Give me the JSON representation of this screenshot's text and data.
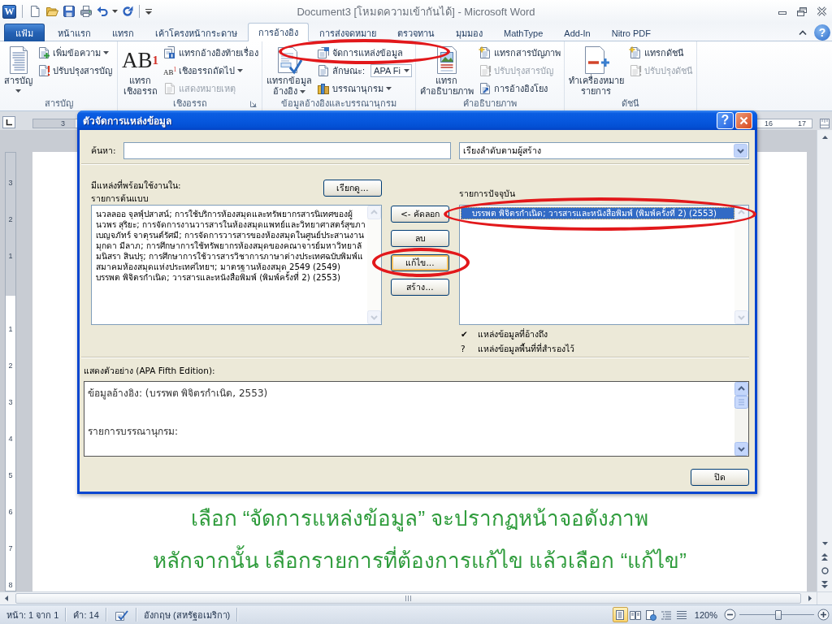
{
  "window": {
    "app_icon_letter": "W",
    "title": "Document3 [โหมดความเข้ากันได้] - Microsoft Word"
  },
  "ribbon": {
    "file_tab": "แฟ้ม",
    "tabs": [
      {
        "label": "หน้าแรก",
        "selected": false
      },
      {
        "label": "แทรก",
        "selected": false
      },
      {
        "label": "เค้าโครงหน้ากระดาษ",
        "selected": false
      },
      {
        "label": "การอ้างอิง",
        "selected": true
      },
      {
        "label": "การส่งจดหมาย",
        "selected": false
      },
      {
        "label": "ตรวจทาน",
        "selected": false
      },
      {
        "label": "มุมมอง",
        "selected": false
      },
      {
        "label": "MathType",
        "selected": false
      },
      {
        "label": "Add-In",
        "selected": false
      },
      {
        "label": "Nitro PDF",
        "selected": false
      }
    ],
    "help_button": "?",
    "groups": [
      {
        "label": "สารบัญ",
        "launcher": false,
        "items": [
          {
            "kind": "large",
            "label": "สารบัญ",
            "dropdown": true,
            "disabled": false,
            "circled": false
          },
          {
            "kind": "small",
            "label": "เพิ่มข้อความ",
            "dropdown": true,
            "disabled": false,
            "circled": false
          },
          {
            "kind": "small",
            "label": "ปรับปรุงสารบัญ",
            "dropdown": false,
            "disabled": false,
            "circled": false
          }
        ]
      },
      {
        "label": "เชิงอรรถ",
        "launcher": true,
        "items": [
          {
            "kind": "large",
            "label": "แทรก\nเชิงอรรถ",
            "icon_text": "AB$^{1}$",
            "dropdown": false,
            "disabled": false,
            "circled": false
          },
          {
            "kind": "small",
            "label": "แทรกอ้างอิงท้ายเรื่อง",
            "dropdown": false,
            "disabled": false,
            "circled": false
          },
          {
            "kind": "small",
            "label": "เชิงอรรถถัดไป",
            "icon_text": "AB$^{1}$",
            "dropdown": true,
            "disabled": false,
            "circled": false
          },
          {
            "kind": "small",
            "label": "แสดงหมายเหตุ",
            "dropdown": false,
            "disabled": true,
            "circled": false
          }
        ]
      },
      {
        "label": "ข้อมูลอ้างอิงและบรรณานุกรม",
        "launcher": false,
        "items": [
          {
            "kind": "large",
            "label": "แทรกข้อมูล\nอ้างอิง",
            "dropdown": true,
            "disabled": false,
            "circled": false
          },
          {
            "kind": "small",
            "label": "จัดการแหล่งข้อมูล",
            "dropdown": false,
            "disabled": false,
            "circled": true
          },
          {
            "kind": "combo",
            "label": "ลักษณะ:",
            "value": "APA Fi",
            "dropdown": true,
            "disabled": false,
            "circled": false
          },
          {
            "kind": "small",
            "label": "บรรณานุกรม",
            "dropdown": true,
            "disabled": false,
            "circled": false
          }
        ]
      },
      {
        "label": "คำอธิบายภาพ",
        "launcher": false,
        "items": [
          {
            "kind": "large",
            "label": "แทรก\nคำอธิบายภาพ",
            "dropdown": false,
            "disabled": false,
            "circled": false
          },
          {
            "kind": "small",
            "label": "แทรกสารบัญภาพ",
            "dropdown": false,
            "disabled": false,
            "circled": false
          },
          {
            "kind": "small",
            "label": "ปรับปรุงสารบัญ",
            "dropdown": false,
            "disabled": true,
            "circled": false
          },
          {
            "kind": "small",
            "label": "การอ้างอิงโยง",
            "dropdown": false,
            "disabled": false,
            "circled": false
          }
        ]
      },
      {
        "label": "ดัชนี",
        "launcher": false,
        "items": [
          {
            "kind": "large",
            "label": "ทำเครื่องหมาย\nรายการ",
            "dropdown": false,
            "disabled": false,
            "circled": false
          },
          {
            "kind": "small",
            "label": "แทรกดัชนี",
            "dropdown": false,
            "disabled": false,
            "circled": false
          },
          {
            "kind": "small",
            "label": "ปรับปรุงดัชนี",
            "dropdown": false,
            "disabled": true,
            "circled": false
          }
        ]
      }
    ]
  },
  "rulers": {
    "horizontal_left_labels": [
      "3"
    ],
    "horizontal_right_labels": [
      "16",
      "17"
    ],
    "vertical_top_labels": [
      "3",
      "2",
      "1"
    ],
    "vertical_body_labels": [
      "1",
      "2",
      "3",
      "4",
      "5",
      "6",
      "7",
      "8"
    ]
  },
  "document": {
    "captions": [
      "เลือก “จัดการแหล่งข้อมูล” จะปรากฏหน้าจอดังภาพ",
      "หลักจากนั้น เลือกรายการที่ต้องการแก้ไข แล้วเลือก “แก้ไข”"
    ]
  },
  "dialog": {
    "title": "ตัวจัดการแหล่งข้อมูล",
    "help_button": "?",
    "search": {
      "label": "ค้นหา:"
    },
    "sort": {
      "value": "เรียงลำดับตามผู้สร้าง"
    },
    "master": {
      "heading": "มีแหล่งที่พร้อมใช้งานใน:",
      "subheading": "รายการต้นแบบ",
      "browse_button": "เรียกดู...",
      "items": [
        {
          "text": "นวลลออ จุลพุ์ปสาสน์; การใช้บริการห้องสมุดและทรัพยากรสารนิเทศของผู้",
          "selected": false
        },
        {
          "text": "นวพร สุริยะ; การจัดการงานวารสารในห้องสมุดแพทย์และวิทยาศาสตร์สุขภา",
          "selected": false
        },
        {
          "text": "เบญจภัทร์ จาตุรนต์รัศมี; การจัดการวารสารของห้องสมุดในศูนย์ประสานงาน",
          "selected": false
        },
        {
          "text": "มุกดา มีลาภ; การศึกษาการใช้ทรัพยากรห้องสมุดของคณาจารย์มหาวิทยาลั",
          "selected": false
        },
        {
          "text": "มนิสรา สินปรุ; การศึกษาการใช้วารสารวิชาการภาษาต่างประเทศฉบับพิมพ์แ",
          "selected": false
        },
        {
          "text": "สมาคมห้องสมุดแห่งประเทศไทยฯ; มาตรฐานห้องสมุด 2549 (2549)",
          "selected": false
        },
        {
          "text": "บรรพต พิจิตรกำเนิด; วารสารและหนังสือพิมพ์ (พิมพ์ครั้งที่ 2) (2553)",
          "selected": false
        }
      ]
    },
    "actions": [
      {
        "label": "<- คัดลอก",
        "focused": false,
        "circled": false
      },
      {
        "label": "ลบ",
        "focused": false,
        "circled": false
      },
      {
        "label": "แก้ไข...",
        "focused": true,
        "circled": true
      },
      {
        "label": "สร้าง...",
        "focused": false,
        "circled": false
      }
    ],
    "current": {
      "heading": "รายการปัจจุบัน",
      "items": [
        {
          "text": "บรรพต พิจิตรกำเนิด; วารสารและหนังสือพิมพ์ (พิมพ์ครั้งที่ 2) (2553)",
          "selected": true,
          "circled": true
        }
      ]
    },
    "legend": [
      {
        "symbol": "✔",
        "text": "แหล่งข้อมูลที่อ้างถึง"
      },
      {
        "symbol": "?",
        "text": "แหล่งข้อมูลพื้นที่ที่สำรองไว้"
      }
    ],
    "preview": {
      "label": "แสดงตัวอย่าง (APA Fifth Edition):",
      "lines": [
        "ข้อมูลอ้างอิง: (บรรพต พิจิตรกำเนิด, 2553)",
        "รายการบรรณานุกรม:"
      ]
    },
    "close_button": "ปิด"
  },
  "status_bar": {
    "page": "หน้า: 1 จาก 1",
    "words": "คำ: 14",
    "language": "อังกฤษ (สหรัฐอเมริกา)",
    "views": [
      {
        "selected": true
      },
      {
        "selected": false
      },
      {
        "selected": false
      },
      {
        "selected": false
      },
      {
        "selected": false
      }
    ],
    "zoom": "120%",
    "zoom_slider": {
      "level": 0.52
    }
  }
}
